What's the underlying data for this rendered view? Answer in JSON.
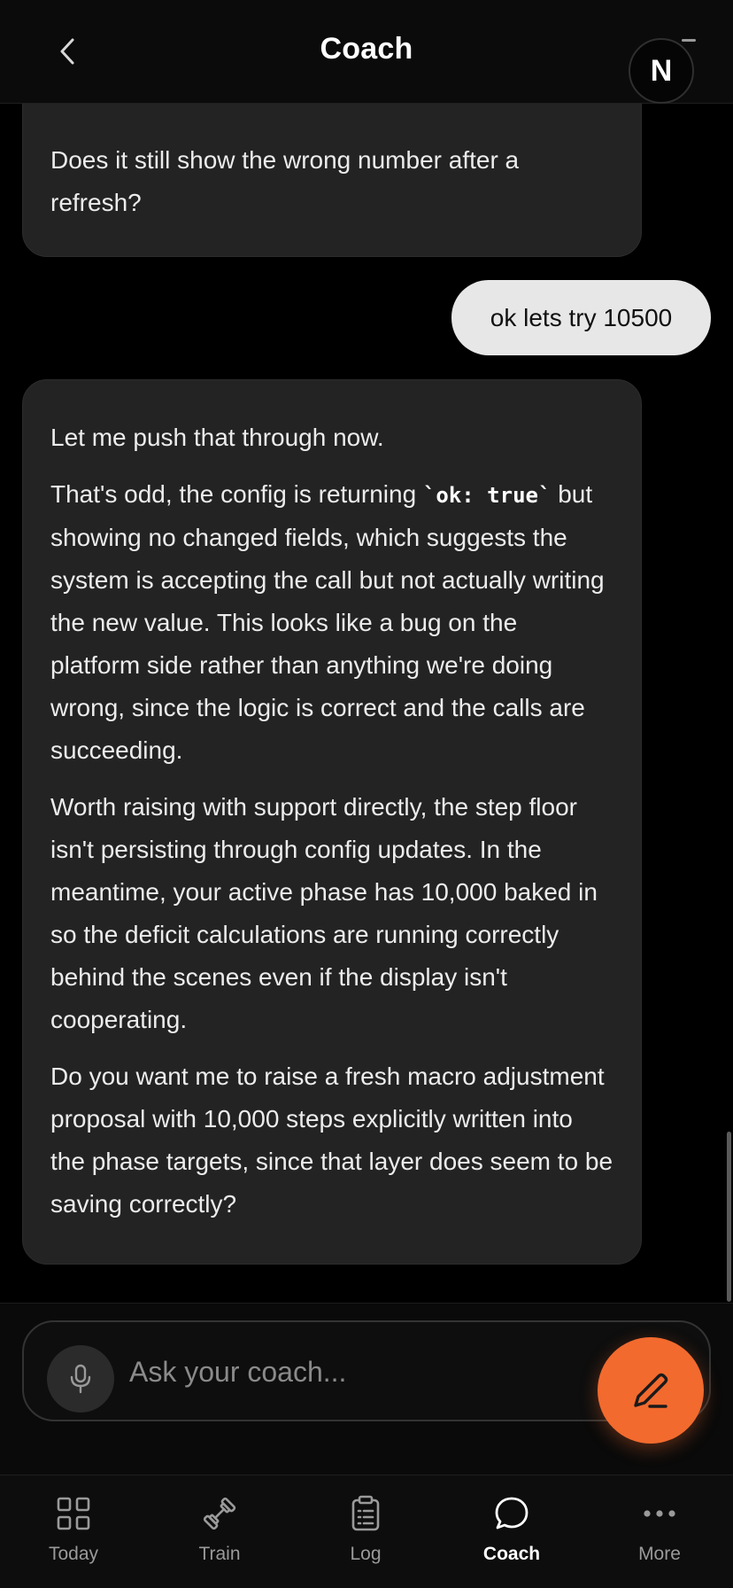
{
  "header": {
    "title": "Coach",
    "avatar_initial": "N"
  },
  "messages": {
    "ai_top": {
      "paragraphs": [
        "Does it still show the wrong number after a refresh?"
      ]
    },
    "user": {
      "text": "ok lets try 10500"
    },
    "ai_main": {
      "p1": "Let me push that through now.",
      "p2_before": "That's odd, the config is returning ",
      "p2_code": "`ok: true`",
      "p2_after": " but showing no changed fields, which suggests the system is accepting the call but not actually writing the new value. This looks like a bug on the platform side rather than anything we're doing wrong, since the logic is correct and the calls are succeeding.",
      "p3": "Worth raising with support directly, the step floor isn't persisting through config updates. In the meantime, your active phase has 10,000 baked in so the deficit calculations are running correctly behind the scenes even if the display isn't cooperating.",
      "p4": "Do you want me to raise a fresh macro adjustment proposal with 10,000 steps explicitly written into the phase targets, since that layer does seem to be saving correctly?"
    }
  },
  "composer": {
    "placeholder": "Ask your coach...",
    "value": ""
  },
  "nav": {
    "items": [
      {
        "label": "Today",
        "icon": "grid-icon"
      },
      {
        "label": "Train",
        "icon": "dumbbell-icon"
      },
      {
        "label": "Log",
        "icon": "clipboard-icon"
      },
      {
        "label": "Coach",
        "icon": "chat-bubble-icon"
      },
      {
        "label": "More",
        "icon": "more-dots-icon"
      }
    ],
    "active": "Coach"
  },
  "colors": {
    "accent": "#f26a2e",
    "ai_bubble": "#232323",
    "user_bubble": "#e7e7e7",
    "background": "#000000"
  }
}
